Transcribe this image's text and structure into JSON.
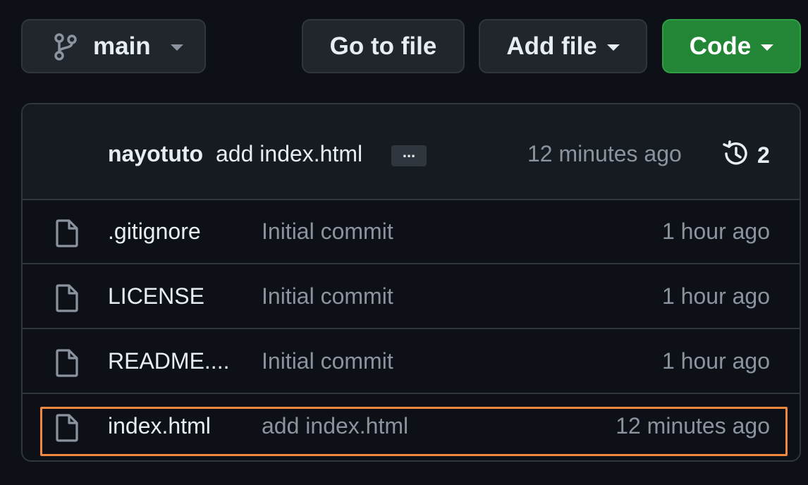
{
  "toolbar": {
    "branch_label": "main",
    "goto_label": "Go to file",
    "addfile_label": "Add file",
    "code_label": "Code"
  },
  "latest_commit": {
    "author": "nayotuto",
    "message": "add index.html",
    "ellipsis": "...",
    "time": "12 minutes ago",
    "history_count": "2"
  },
  "files": [
    {
      "name": ".gitignore",
      "commit": "Initial commit",
      "time": "1 hour ago",
      "icon": "file-icon"
    },
    {
      "name": "LICENSE",
      "commit": "Initial commit",
      "time": "1 hour ago",
      "icon": "file-icon"
    },
    {
      "name": "README....",
      "commit": "Initial commit",
      "time": "1 hour ago",
      "icon": "file-icon"
    },
    {
      "name": "index.html",
      "commit": "add index.html",
      "time": "12 minutes ago",
      "icon": "file-icon"
    }
  ],
  "colors": {
    "background": "#0d1117",
    "code_button": "#238636",
    "highlight": "#f0883e"
  }
}
